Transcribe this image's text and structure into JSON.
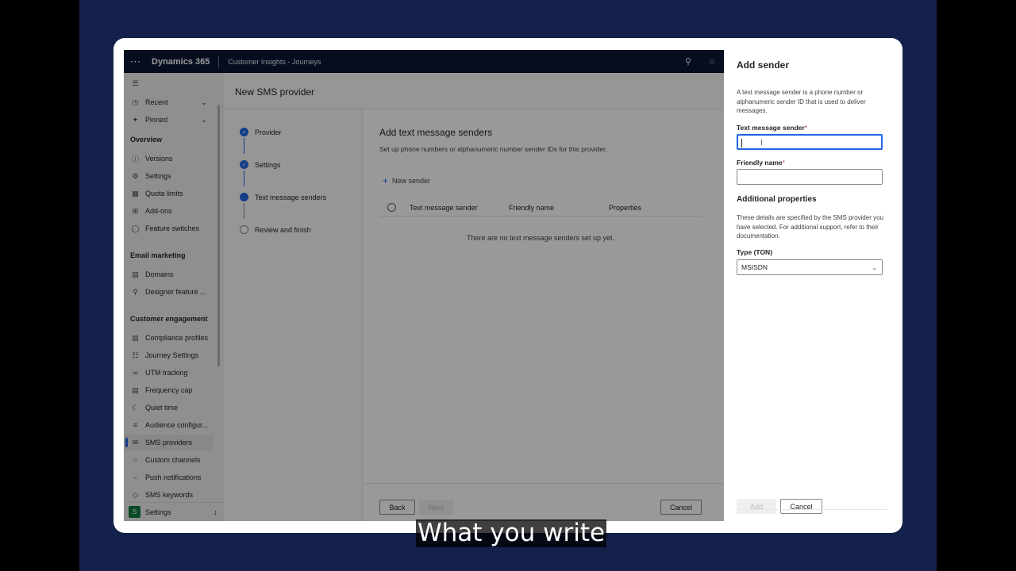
{
  "topbar": {
    "brand": "Dynamics 365",
    "app_name": "Customer Insights - Journeys",
    "icons": [
      "waffle-icon",
      "search-icon",
      "lightbulb-icon"
    ]
  },
  "sidebar": {
    "top_items": [
      {
        "label": "Recent",
        "icon": "clock-icon"
      },
      {
        "label": "Pinned",
        "icon": "pin-icon"
      }
    ],
    "groups": [
      {
        "title": "Overview",
        "items": [
          "Versions",
          "Settings",
          "Quota limits",
          "Add-ons",
          "Feature switches"
        ]
      },
      {
        "title": "Email marketing",
        "items": [
          "Domains",
          "Designer feature ..."
        ]
      },
      {
        "title": "Customer engagement",
        "items": [
          "Compliance profiles",
          "Journey Settings",
          "UTM tracking",
          "Frequency cap",
          "Quiet time",
          "Audience configur...",
          "SMS providers",
          "Custom channels",
          "Push notifications",
          "SMS keywords"
        ]
      }
    ],
    "selected": "SMS providers",
    "area_avatar": "S",
    "area_label": "Settings"
  },
  "main": {
    "page_title": "New SMS provider",
    "steps": [
      {
        "label": "Provider",
        "state": "done"
      },
      {
        "label": "Settings",
        "state": "done"
      },
      {
        "label": "Text message senders",
        "state": "current"
      },
      {
        "label": "Review and finish",
        "state": "todo"
      }
    ],
    "content_title": "Add text message senders",
    "content_desc": "Set up phone numbers or alphanumeric number sender IDs for this provider.",
    "new_sender": "New sender",
    "columns": [
      "Text message sender",
      "Friendly name",
      "Properties"
    ],
    "empty_text": "There are no text message senders set up yet.",
    "back": "Back",
    "next": "Next",
    "cancel": "Cancel"
  },
  "panel": {
    "title": "Add sender",
    "description": "A text message sender is a phone number or alphanumeric sender ID that is used to deliver messages.",
    "sender_label": "Text message sender",
    "sender_value": "",
    "friendly_label": "Friendly name",
    "friendly_value": "",
    "required_mark": "*",
    "additional_title": "Additional properties",
    "additional_desc": "These details are specified by the SMS provider you have selected. For additional support, refer to their documentation.",
    "type_label": "Type (TON)",
    "type_value": "MSISDN",
    "add": "Add",
    "cancel": "Cancel"
  },
  "caption": "What you write"
}
